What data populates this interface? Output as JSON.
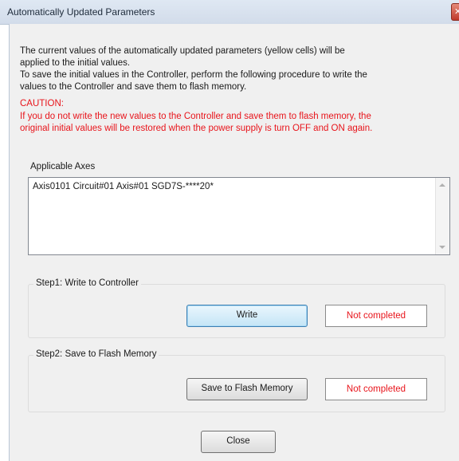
{
  "window": {
    "title": "Automatically Updated Parameters",
    "close_glyph": "✕"
  },
  "message": {
    "line1": "The current values of the automatically updated parameters (yellow cells) will be",
    "line2": "applied to the initial values.",
    "line3": "To save the initial values in the Controller, perform the following procedure to write the",
    "line4": "values to the Controller and save them to flash memory.",
    "caution_label": "CAUTION:",
    "caution_line1": "If you do not write the new values to the Controller and save them to flash memory, the",
    "caution_line2": "original initial values will be restored when the power supply is turn OFF and ON again."
  },
  "axes": {
    "label": "Applicable Axes",
    "items": [
      "Axis0101 Circuit#01 Axis#01 SGD7S-****20*"
    ]
  },
  "step1": {
    "title": "Step1: Write to Controller",
    "button_label": "Write",
    "status": "Not completed"
  },
  "step2": {
    "title": "Step2: Save to Flash Memory",
    "button_label": "Save to Flash Memory",
    "status": "Not completed"
  },
  "footer": {
    "close_label": "Close"
  },
  "colors": {
    "caution_red": "#e8141b",
    "status_red": "#e8141b"
  },
  "icons": {
    "close": "close-icon",
    "scroll_up": "scroll-up-icon",
    "scroll_down": "scroll-down-icon"
  }
}
